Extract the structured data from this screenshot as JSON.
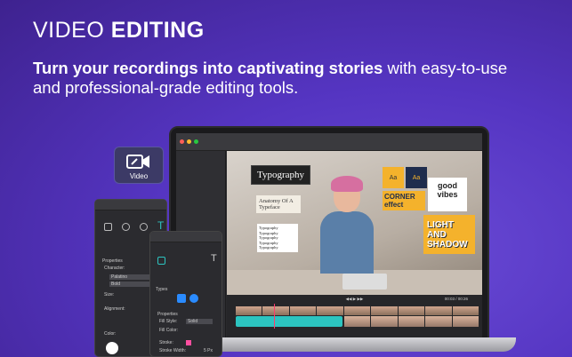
{
  "hero": {
    "title_light": "VIDEO",
    "title_bold": "EDITING",
    "tagline_bold": "Turn your recordings into captivating stories",
    "tagline_rest": " with easy-to-use and professional-grade editing tools."
  },
  "video_tile": {
    "label": "Video",
    "icon": "video-edit-icon"
  },
  "canvas": {
    "typography_card": "Typography",
    "anatomy_card": "Anatomy Of A Typeface",
    "multi_card": [
      "Typography",
      "Typography",
      "Typography",
      "Typography",
      "Typography"
    ],
    "sticker_aa1": "Aa",
    "sticker_aa2": "Aa",
    "sticker_corner": "CORNER effect",
    "sticker_good": "good vibes",
    "sticker_light": "LIGHT AND SHADOW"
  },
  "timeline": {
    "time": "00:03 / 00:26"
  },
  "panel_large": {
    "properties": "Properties",
    "character": "Character:",
    "font": "Palatino",
    "weight": "Bold",
    "size": "Size:",
    "alignment": "Alignment:",
    "color": "Color:"
  },
  "panel_small": {
    "types": "Types",
    "properties": "Properties",
    "fill_style": "Fill Style:",
    "fill_style_value": "Solid",
    "fill_color": "Fill Color:",
    "stroke": "Stroke:",
    "stroke_width": "Stroke Width:",
    "stroke_width_value": "5 Px"
  },
  "colors": {
    "accent": "#5535c2",
    "teal": "#2cc4c0",
    "yellow": "#f4b22c"
  }
}
